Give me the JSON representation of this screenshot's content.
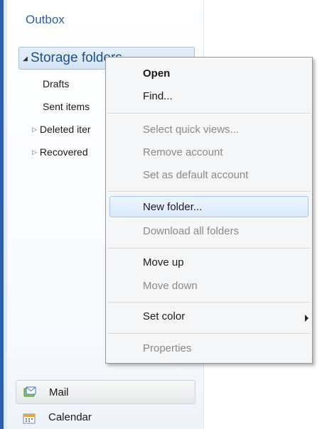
{
  "folder_pane": {
    "outbox_label": "Outbox",
    "storage_folders_label": "Storage folders",
    "items": [
      {
        "label": "Drafts"
      },
      {
        "label": "Sent items"
      },
      {
        "label": "Deleted iter"
      },
      {
        "label": "Recovered"
      }
    ]
  },
  "nav": {
    "mail_label": "Mail",
    "calendar_label": "Calendar"
  },
  "context_menu": {
    "items": [
      {
        "label": "Open"
      },
      {
        "label": "Find..."
      },
      {
        "label": "Select quick views..."
      },
      {
        "label": "Remove account"
      },
      {
        "label": "Set as default account"
      },
      {
        "label": "New folder..."
      },
      {
        "label": "Download all folders"
      },
      {
        "label": "Move up"
      },
      {
        "label": "Move down"
      },
      {
        "label": "Set color"
      },
      {
        "label": "Properties"
      }
    ]
  },
  "colors": {
    "accent": "#2f5fa8",
    "link_blue": "#2a60a0",
    "highlight_border": "#a9c7ea"
  },
  "icons": {
    "expanded": "triangle-down-icon",
    "collapsed": "triangle-right-icon",
    "submenu": "chevron-right-icon",
    "mail": "mail-icon",
    "calendar": "calendar-icon"
  }
}
